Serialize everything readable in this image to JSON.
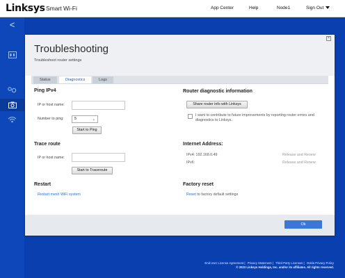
{
  "header": {
    "logo": "Linksys",
    "product": "Smart Wi-Fi",
    "nav": [
      "App Center",
      "Help",
      "Node1",
      "Sign Out"
    ]
  },
  "sidebar": {
    "back_glyph": "<",
    "items": [
      {
        "icon": "network-map-icon",
        "active": false
      },
      {
        "icon": "devices-icon",
        "active": false
      },
      {
        "icon": "troubleshooting-camera-icon",
        "active": true
      },
      {
        "icon": "wifi-settings-icon",
        "active": false
      }
    ]
  },
  "page": {
    "title": "Troubleshooting",
    "subtitle": "Troubleshoot router settings",
    "tabs": [
      "Status",
      "Diagnostics",
      "Logs"
    ],
    "active_tab": "Diagnostics"
  },
  "ping": {
    "title": "Ping IPv4",
    "host_label": "IP or host name:",
    "host_value": "",
    "count_label": "Number to ping:",
    "count_value": "5",
    "button": "Start to Ping"
  },
  "trace": {
    "title": "Trace route",
    "host_label": "IP or host name:",
    "host_value": "",
    "button": "Start to Traceroute"
  },
  "restart": {
    "title": "Restart",
    "link": "Restart mesh WiFi system"
  },
  "router_diag": {
    "title": "Router diagnostic information",
    "button": "Share router info with Linksys",
    "checkbox_text": "I want to contribute to future improvements by reporting router errors and diagnostics to Linksys.",
    "checked": false
  },
  "internet": {
    "title": "Internet Address:",
    "ipv4_label": "IPv4: 192.168.0.49",
    "ipv6_label": "IPv6:",
    "release_renew": "Release and Renew"
  },
  "factory": {
    "title": "Factory reset",
    "link": "Reset",
    "text": "to factory default settings"
  },
  "footer": {
    "ok": "Ok",
    "links": [
      "End User License Agreement",
      "Privacy Statement",
      "Third Party Licenses",
      "Ookla Privacy Policy"
    ],
    "copyright": "© 2023 Linksys Holdings, Inc. and/or its affiliates. All rights reserved."
  },
  "colors": {
    "background": "#0a3fb0",
    "accent": "#3a77d6",
    "link": "#2b6fd6"
  }
}
